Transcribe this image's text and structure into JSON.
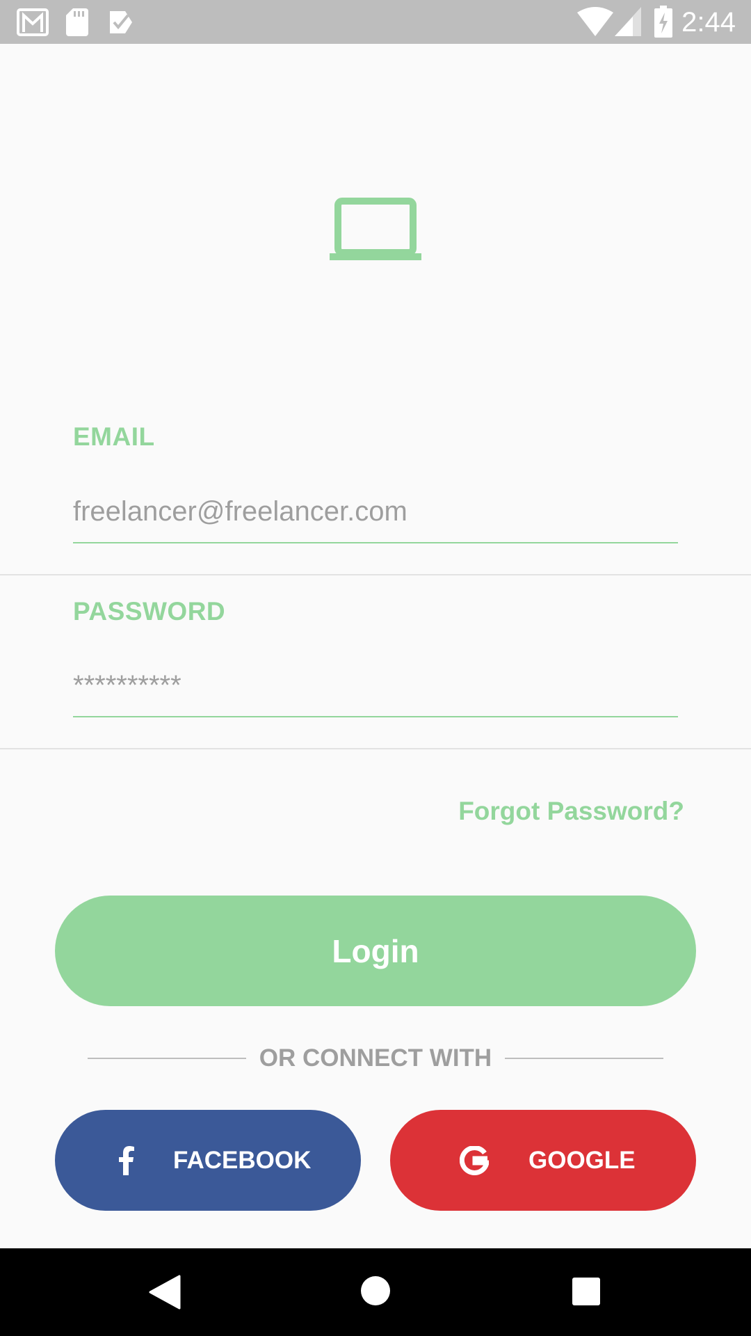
{
  "status_bar": {
    "time": "2:44",
    "icons_left": [
      "gmail-icon",
      "sd-card-icon",
      "task-check-icon"
    ],
    "icons_right": [
      "wifi-icon",
      "signal-icon",
      "battery-charging-icon"
    ]
  },
  "logo": {
    "icon": "laptop-icon",
    "color": "#93d69c"
  },
  "form": {
    "email_label": "EMAIL",
    "email_value": "freelancer@freelancer.com",
    "password_label": "PASSWORD",
    "password_value": "**********",
    "forgot_password": "Forgot Password?"
  },
  "login_button": "Login",
  "or_connect": "OR CONNECT WITH",
  "social": {
    "facebook_label": "FACEBOOK",
    "facebook_icon": "facebook-f-icon",
    "google_label": "GOOGLE",
    "google_icon": "google-g-icon"
  },
  "nav_bar": {
    "icons": [
      "back-icon",
      "home-icon",
      "recents-icon"
    ]
  },
  "colors": {
    "accent": "#93d69c",
    "facebook": "#3b5998",
    "google": "#dc3237",
    "status_bar": "#bdbdbd",
    "background": "#fafafa"
  }
}
